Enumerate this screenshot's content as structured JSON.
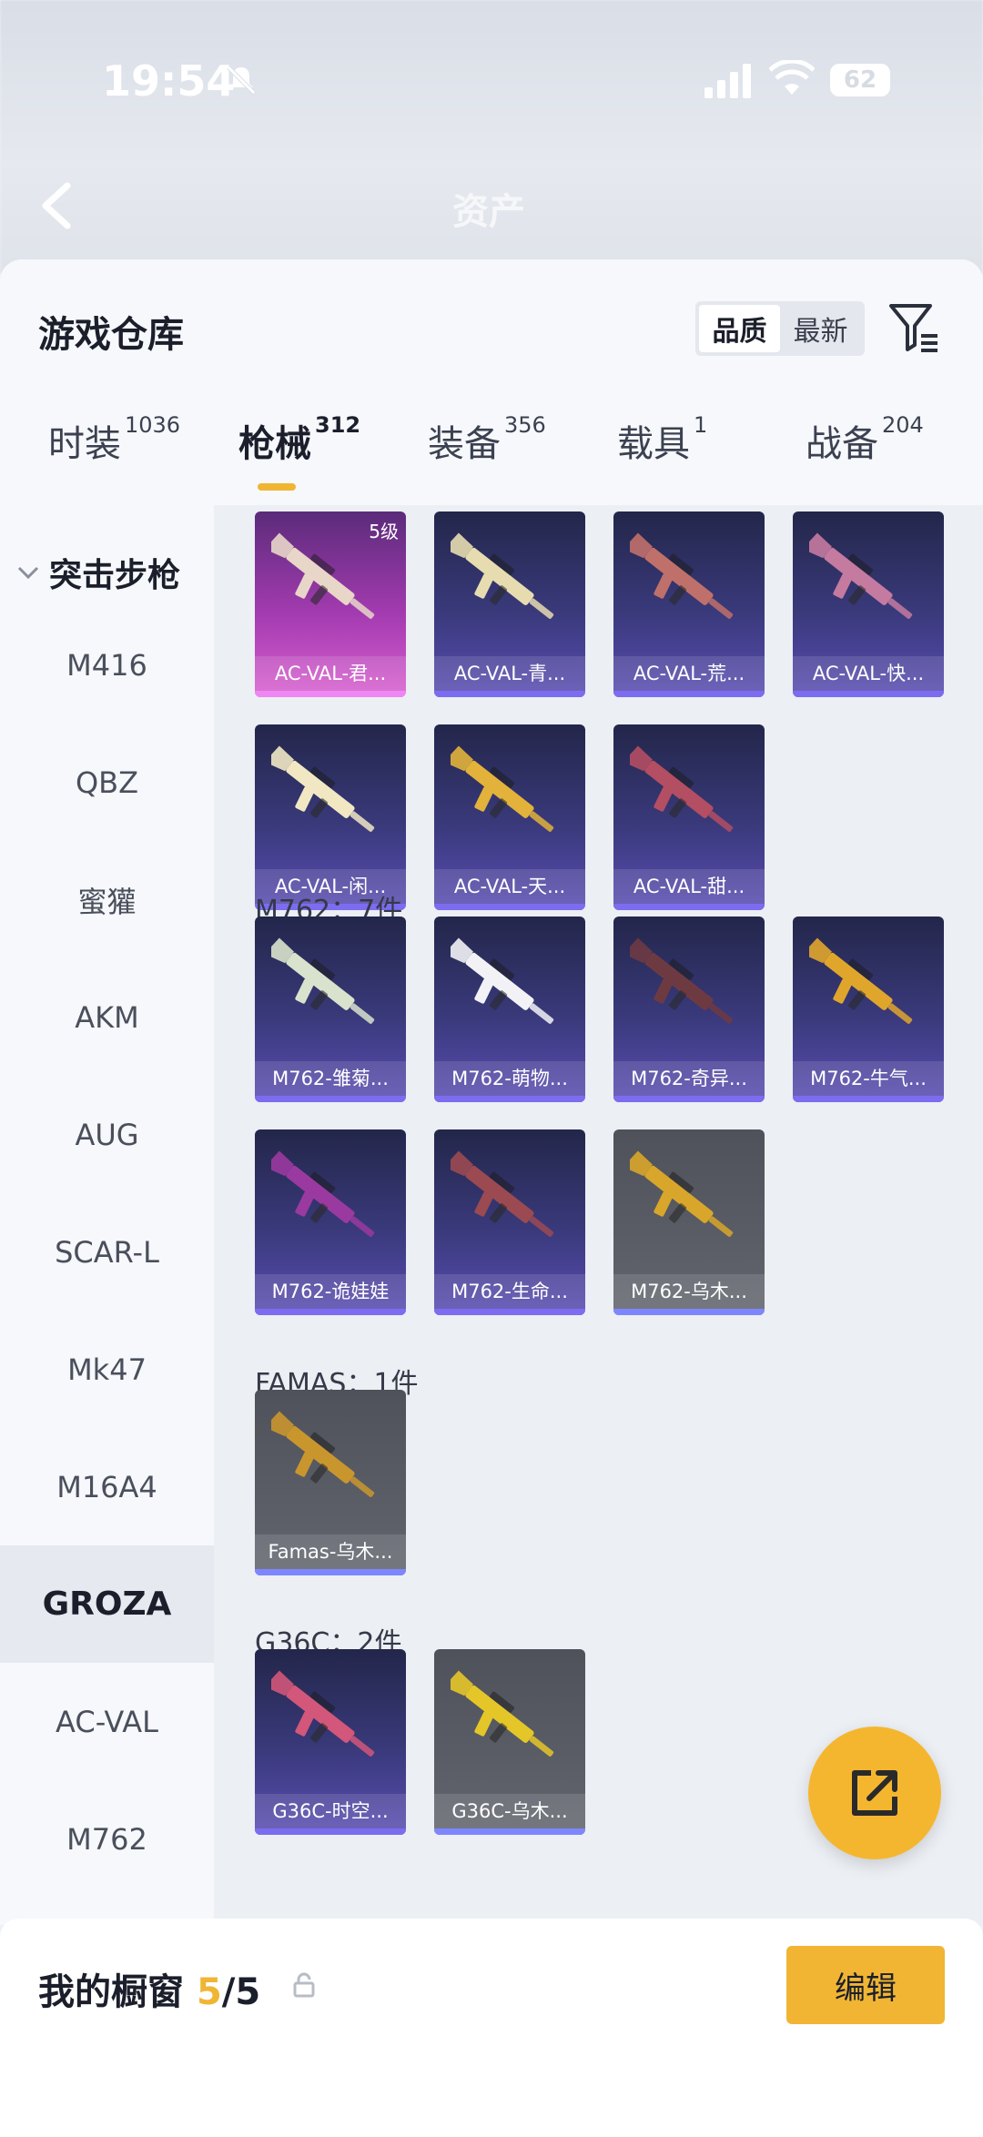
{
  "status_bar": {
    "time": "19:54",
    "battery": "62"
  },
  "background_header": {
    "title": "资产"
  },
  "warehouse": {
    "title": "游戏仓库",
    "sort_options": [
      "品质",
      "最新"
    ],
    "active_sort": "品质"
  },
  "tabs": [
    {
      "label": "时装",
      "count": "1036"
    },
    {
      "label": "枪械",
      "count": "312"
    },
    {
      "label": "装备",
      "count": "356"
    },
    {
      "label": "载具",
      "count": "1"
    },
    {
      "label": "战备",
      "count": "204"
    }
  ],
  "sidebar": {
    "group": "突击步枪",
    "items": [
      "M416",
      "QBZ",
      "蜜獾",
      "AKM",
      "AUG",
      "SCAR-L",
      "Mk47",
      "M16A4",
      "GROZA",
      "AC-VAL",
      "M762"
    ],
    "active": "GROZA"
  },
  "sections": [
    {
      "title": "",
      "items": [
        {
          "label": "AC-VAL-君...",
          "style": "pink",
          "level": "5级",
          "gun_color": "#e8d6c8"
        },
        {
          "label": "AC-VAL-青...",
          "style": "purple",
          "gun_color": "#e6dcb0"
        },
        {
          "label": "AC-VAL-荒...",
          "style": "purple",
          "gun_color": "#c0706a"
        },
        {
          "label": "AC-VAL-快...",
          "style": "purple",
          "gun_color": "#c57aa0"
        },
        {
          "label": "AC-VAL-闲...",
          "style": "purple",
          "gun_color": "#f1e8c3"
        },
        {
          "label": "AC-VAL-天...",
          "style": "purple",
          "gun_color": "#e2b23b"
        },
        {
          "label": "AC-VAL-甜...",
          "style": "purple",
          "gun_color": "#b34e63"
        }
      ]
    },
    {
      "title": "M762：7件",
      "items": [
        {
          "label": "M762-雏菊...",
          "style": "purple",
          "gun_color": "#d9e2cc"
        },
        {
          "label": "M762-萌物...",
          "style": "purple",
          "gun_color": "#f2f2f6"
        },
        {
          "label": "M762-奇异...",
          "style": "purple",
          "gun_color": "#6e3a42"
        },
        {
          "label": "M762-牛气...",
          "style": "purple",
          "gun_color": "#e0a62c"
        },
        {
          "label": "M762-诡娃娃",
          "style": "purple",
          "gun_color": "#9a3aa0"
        },
        {
          "label": "M762-生命...",
          "style": "purple",
          "gun_color": "#9b4a52"
        },
        {
          "label": "M762-乌木...",
          "style": "grey",
          "gun_color": "#d8a62a"
        }
      ]
    },
    {
      "title": "FAMAS：1件",
      "items": [
        {
          "label": "Famas-乌木...",
          "style": "grey",
          "gun_color": "#c9962e"
        }
      ]
    },
    {
      "title": "G36C：2件",
      "items": [
        {
          "label": "G36C-时空...",
          "style": "purple",
          "gun_color": "#d2577a"
        },
        {
          "label": "G36C-乌木...",
          "style": "grey",
          "gun_color": "#e5c629"
        }
      ]
    }
  ],
  "showcase": {
    "title": "我的橱窗",
    "used": "5",
    "separator": "/",
    "total": "5",
    "edit_label": "编辑"
  },
  "colors": {
    "accent": "#f0b533",
    "fab": "#f5b62f"
  }
}
